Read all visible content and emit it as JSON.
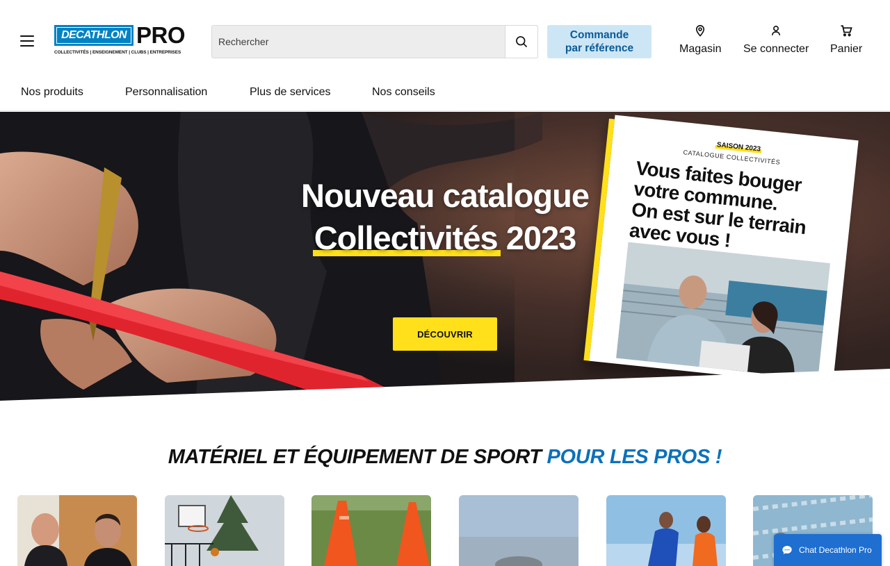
{
  "header": {
    "logo": {
      "brand": "DECATHLON",
      "suffix": "PRO",
      "tagline": "COLLECTIVITÉS | ENSEIGNEMENT | CLUBS | ENTREPRISES"
    },
    "search": {
      "placeholder": "Rechercher",
      "icon": "search-icon"
    },
    "order_by_reference": {
      "line1": "Commande",
      "line2": "par référence"
    },
    "store": {
      "label": "Magasin",
      "icon": "location-pin-icon"
    },
    "login": {
      "label": "Se connecter",
      "icon": "user-icon"
    },
    "cart": {
      "label": "Panier",
      "icon": "cart-icon"
    }
  },
  "nav": {
    "items": [
      {
        "label": "Nos produits"
      },
      {
        "label": "Personnalisation"
      },
      {
        "label": "Plus de services"
      },
      {
        "label": "Nos conseils"
      }
    ]
  },
  "hero": {
    "title_line1": "Nouveau catalogue",
    "title_highlight": "Collectivités",
    "title_year": "2023",
    "cta": "DÉCOUVRIR",
    "catalog": {
      "season": "SAISON 2023",
      "subtitle": "CATALOGUE COLLECTIVITÉS",
      "lines": [
        "Vous faites bouger",
        "votre commune.",
        "On est sur le terrain",
        "avec vous !"
      ]
    }
  },
  "section": {
    "title_main": "MATÉRIEL ET ÉQUIPEMENT DE SPORT",
    "title_accent": "POUR LES PROS !"
  },
  "chat": {
    "label": "Chat Decathlon Pro",
    "icon": "chat-bubble-icon"
  },
  "colors": {
    "brand_blue": "#0082c3",
    "accent_blue": "#0b71bb",
    "yellow": "#ffe01b",
    "chat_blue": "#1e6fd0",
    "order_button_bg": "#cde6f6"
  }
}
